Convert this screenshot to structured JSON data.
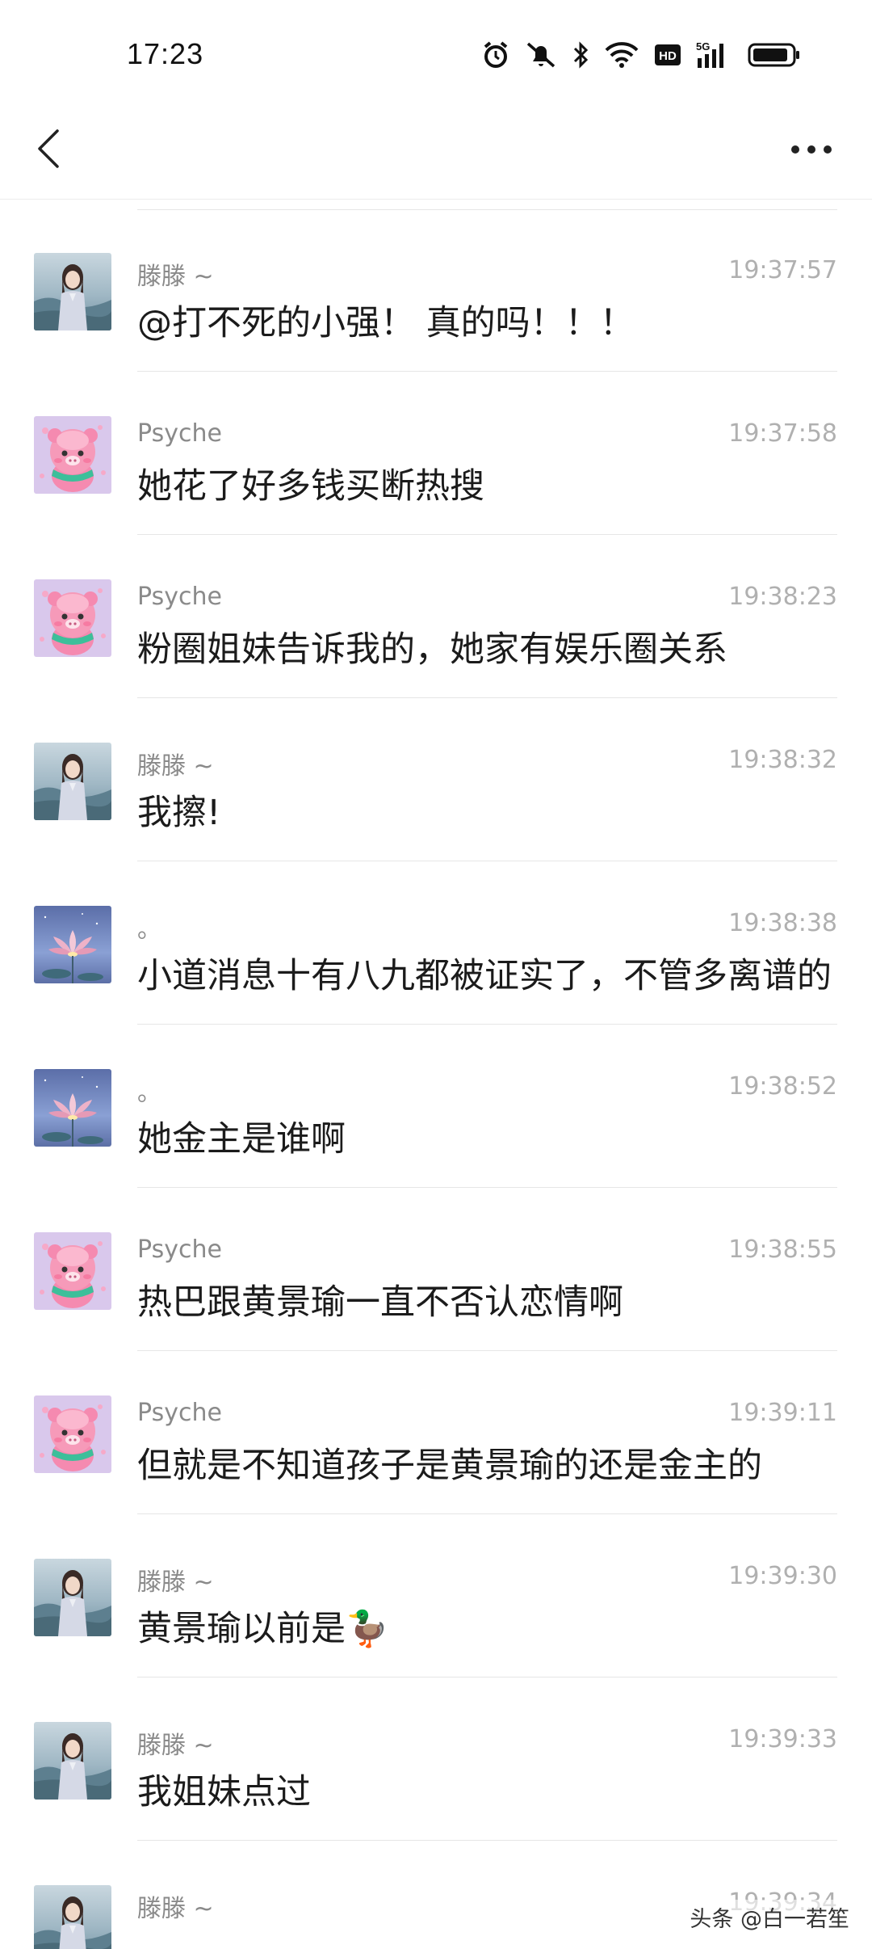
{
  "status_bar": {
    "time": "17:23",
    "icons": [
      "alarm-icon",
      "bell-mute-icon",
      "bluetooth-icon",
      "wifi-icon",
      "hd-icon",
      "signal-5g-icon",
      "battery-icon"
    ],
    "hd_label": "HD",
    "network_label": "5G"
  },
  "nav": {
    "back_icon": "chevron-left-icon",
    "more_icon": "more-horizontal-icon"
  },
  "messages": [
    {
      "sender": "滕滕 ~",
      "time": "19:37:57",
      "text": "@打不死的小强！ 真的吗！！！",
      "avatar": "girl"
    },
    {
      "sender": "Psyche",
      "time": "19:37:58",
      "text": "她花了好多钱买断热搜",
      "avatar": "pig"
    },
    {
      "sender": "Psyche",
      "time": "19:38:23",
      "text": "粉圈姐妹告诉我的，她家有娱乐圈关系",
      "avatar": "pig"
    },
    {
      "sender": "滕滕 ~",
      "time": "19:38:32",
      "text": "我擦!",
      "avatar": "girl"
    },
    {
      "sender": "。",
      "time": "19:38:38",
      "text": "小道消息十有八九都被证实了，不管多离谱的",
      "avatar": "lotus"
    },
    {
      "sender": "。",
      "time": "19:38:52",
      "text": "她金主是谁啊",
      "avatar": "lotus"
    },
    {
      "sender": "Psyche",
      "time": "19:38:55",
      "text": "热巴跟黄景瑜一直不否认恋情啊",
      "avatar": "pig"
    },
    {
      "sender": "Psyche",
      "time": "19:39:11",
      "text": "但就是不知道孩子是黄景瑜的还是金主的",
      "avatar": "pig"
    },
    {
      "sender": "滕滕 ~",
      "time": "19:39:30",
      "text": "黄景瑜以前是🦆",
      "avatar": "girl"
    },
    {
      "sender": "滕滕 ~",
      "time": "19:39:33",
      "text": "我姐妹点过",
      "avatar": "girl"
    },
    {
      "sender": "滕滕 ~",
      "time": "19:39:34",
      "text": "",
      "avatar": "girl"
    }
  ],
  "watermark": "头条 @白一若笙"
}
